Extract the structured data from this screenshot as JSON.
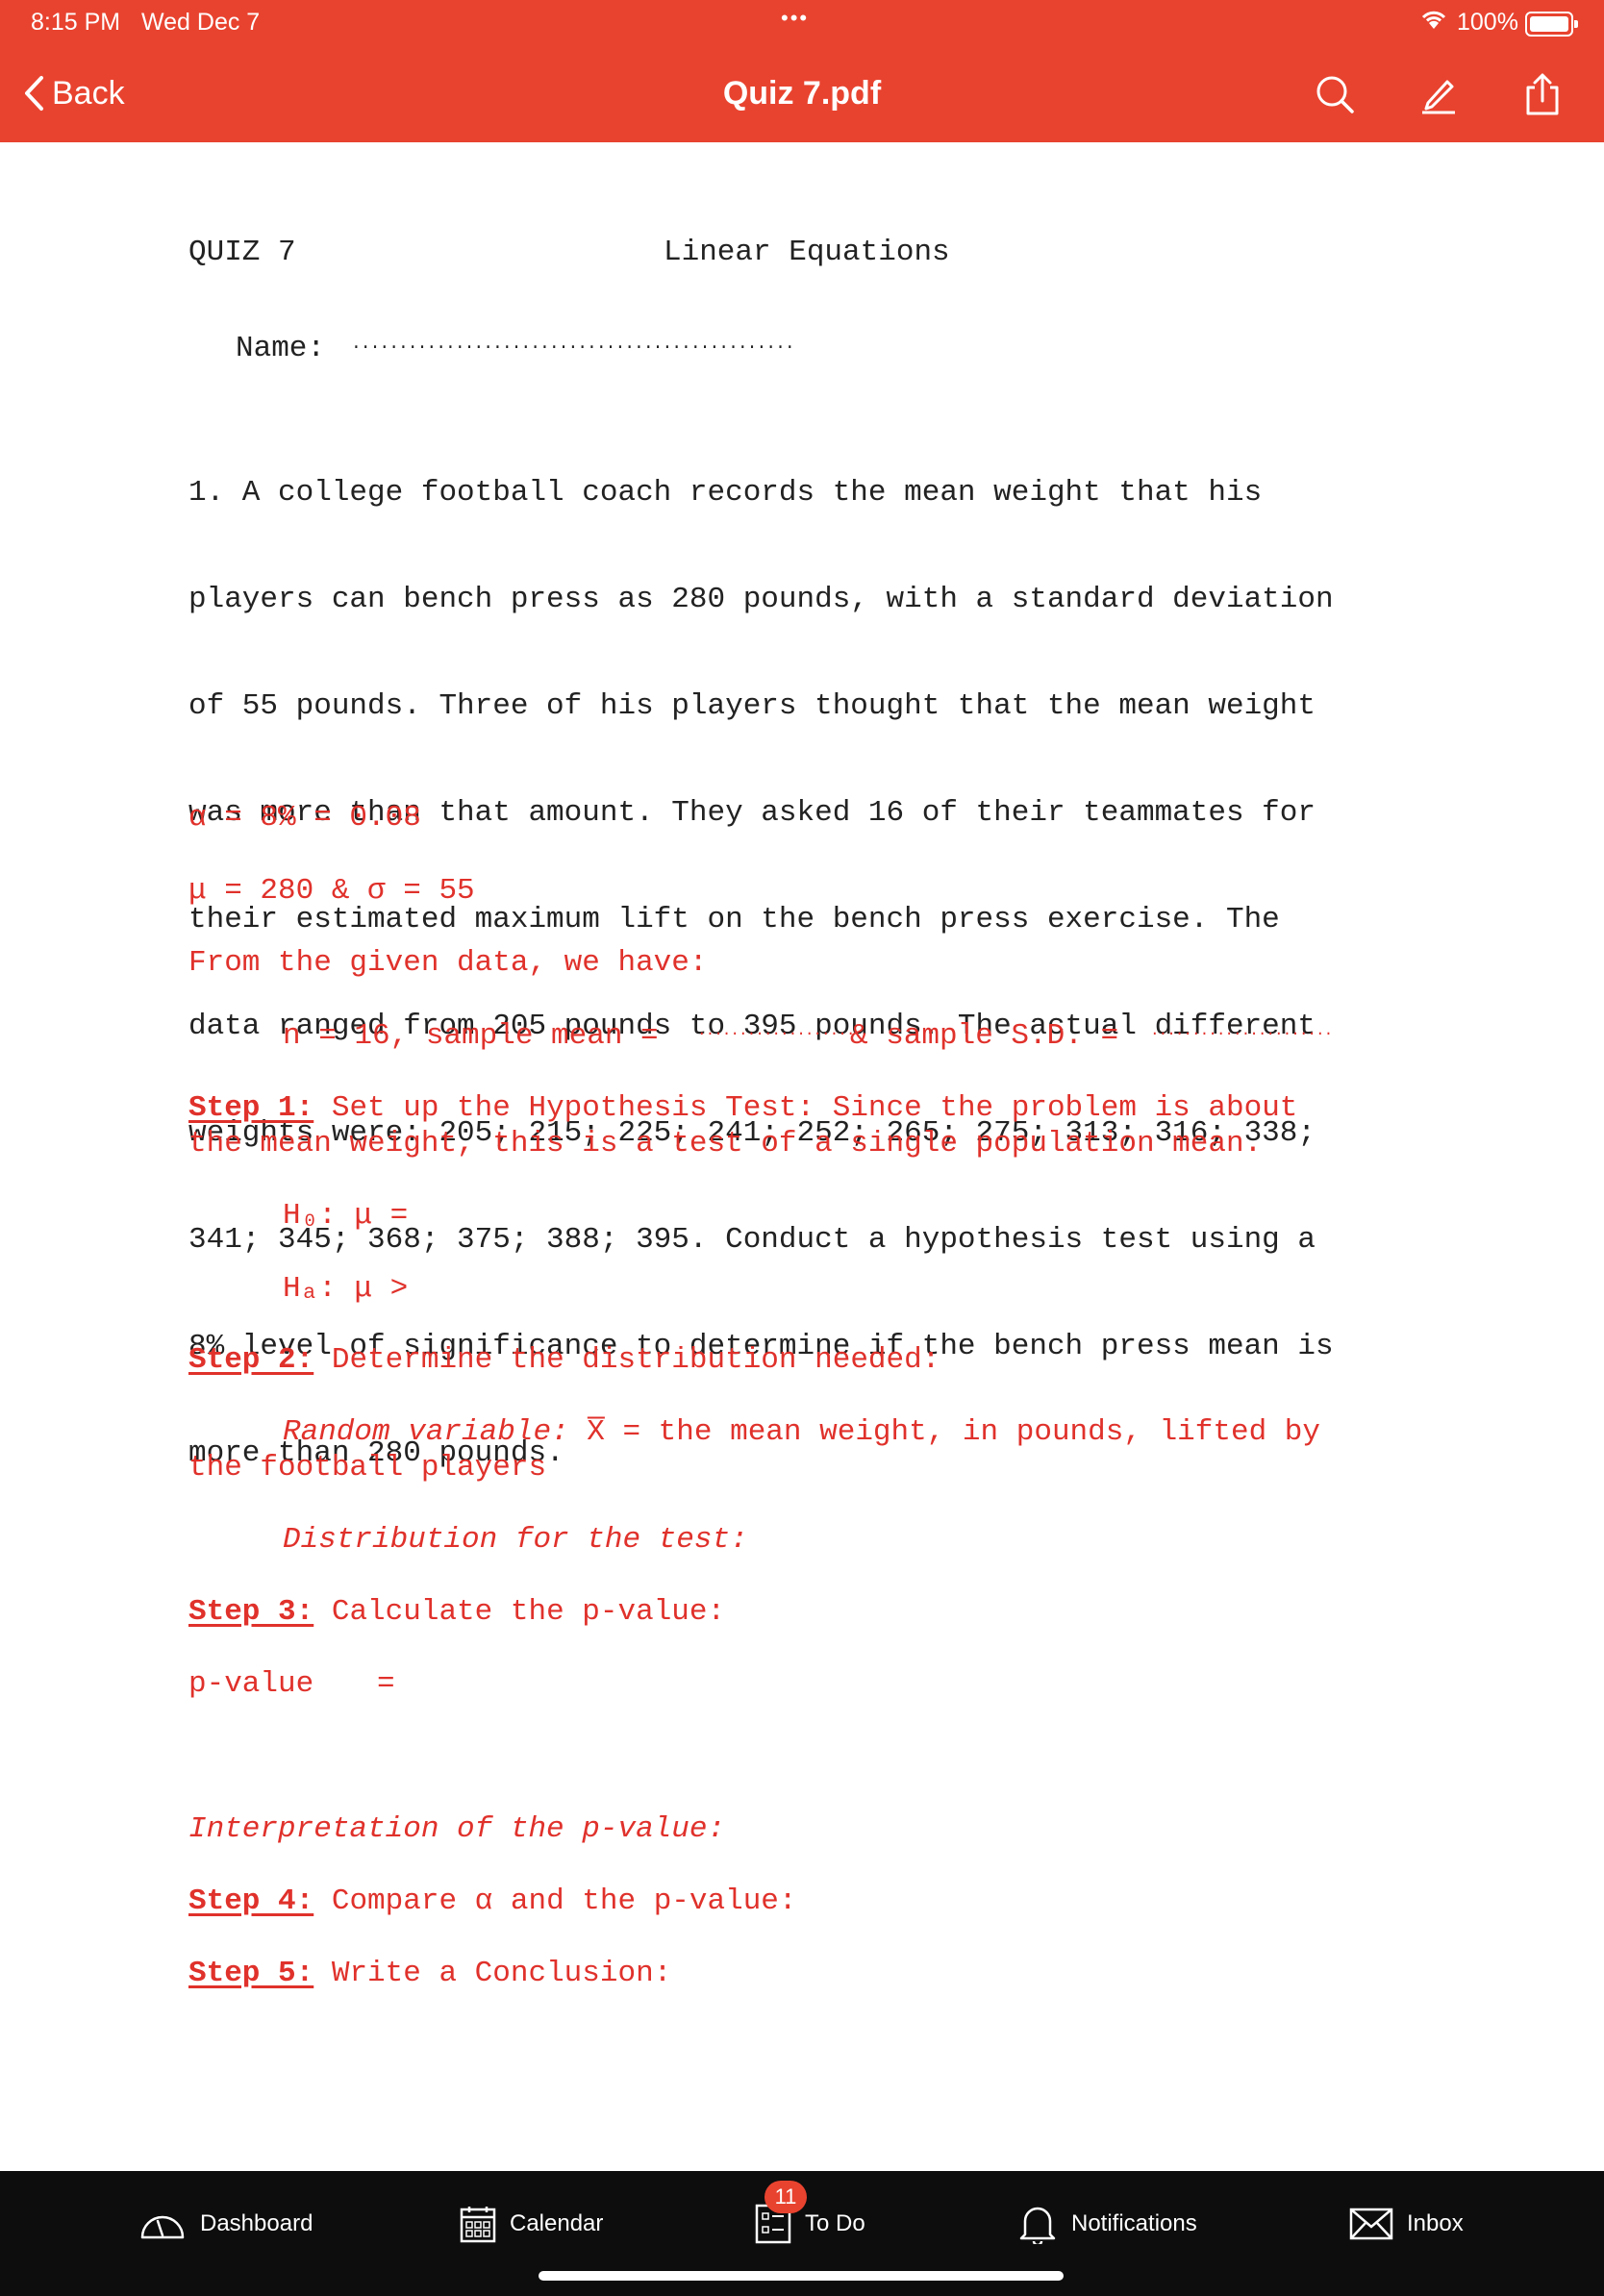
{
  "status": {
    "time": "8:15 PM",
    "date": "Wed Dec 7",
    "dots": "•••",
    "battery": "100%",
    "accent": "#e8432f"
  },
  "nav": {
    "back_label": "Back",
    "title": "Quiz 7.pdf",
    "icons": [
      "search-icon",
      "annotate-pen-icon",
      "share-icon"
    ]
  },
  "doc": {
    "quiz_label": "QUIZ 7",
    "topic": "Linear Equations",
    "name_label": "Name:",
    "name_blank": "...............................................",
    "problem": [
      "1. A college football coach records the mean weight that his",
      "players can bench press as 280 pounds, with a standard deviation",
      "of 55 pounds. Three of his players thought that the mean weight",
      "was more than that amount. They asked 16 of their teammates for",
      "their estimated maximum lift on the bench press exercise. The",
      "data ranged from 205 pounds to 395 pounds. The actual different",
      "weights were: 205; 215; 225; 241; 252; 265; 275; 313; 316; 338;",
      "341; 345; 368; 375; 388; 395. Conduct a hypothesis test using a",
      "8% level of significance to determine if the bench press mean is",
      "more than 280 pounds."
    ],
    "alpha_line": "α = 8% = 0.08",
    "mu_line": "μ = 280 & σ = 55",
    "given_line": "From the given data, we have:",
    "n_line": "n = 16, sample mean =",
    "mean_blank": "...................",
    "sd_label": "& sample S.D. =",
    "sd_blank": "......................",
    "step1_label": "Step 1:",
    "step1_text_a": " Set up the Hypothesis Test: Since the problem is about",
    "step1_text_b": "the mean weight, this is a test of a single population mean.",
    "h0_line": "H₀: μ =",
    "ha_line": "Hₐ: μ >",
    "step2_label": "Step 2:",
    "step2_text": " Determine the distribution needed:",
    "rv_label": "Random variable:",
    "rv_symbol": " X̅",
    "rv_text": " = the mean weight, in pounds, lifted by",
    "rv_text2": "the football players",
    "dist_label": "Distribution for the test:",
    "step3_label": "Step 3:",
    "step3_text": " Calculate the p-value:",
    "pvalue_label": "p-value",
    "pvalue_eq": "=",
    "interp_label": "Interpretation of the p-value:",
    "step4_label": "Step 4:",
    "step4_text": " Compare α and the p-value:",
    "step5_label": "Step 5:",
    "step5_text": " Write a Conclusion:"
  },
  "tabbar": {
    "dashboard": "Dashboard",
    "calendar": "Calendar",
    "todo": "To Do",
    "todo_badge": "11",
    "notifications": "Notifications",
    "inbox": "Inbox"
  }
}
